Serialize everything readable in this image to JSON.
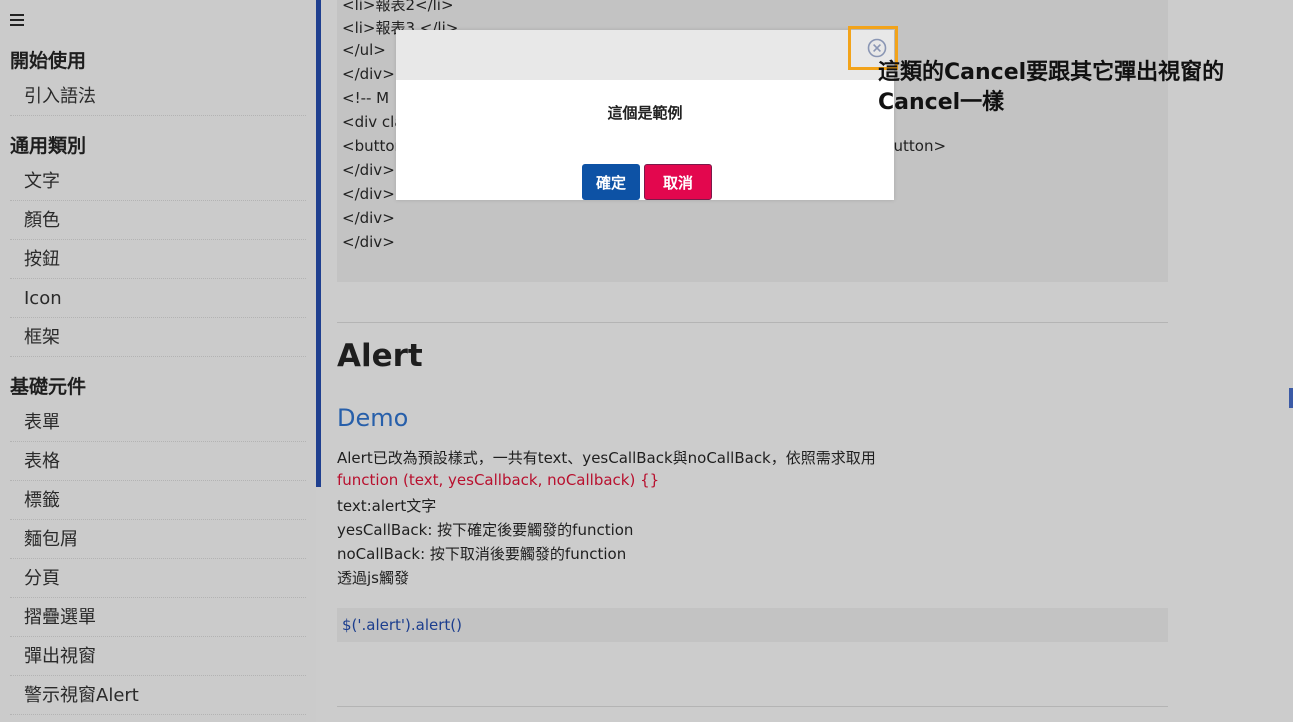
{
  "sidebar": {
    "sections": [
      {
        "title": "開始使用",
        "items": [
          "引入語法"
        ]
      },
      {
        "title": "通用類別",
        "items": [
          "文字",
          "顏色",
          "按鈕",
          "Icon",
          "框架"
        ]
      },
      {
        "title": "基礎元件",
        "items": [
          "表單",
          "表格",
          "標籤",
          "麵包屑",
          "分頁",
          "摺疊選單",
          "彈出視窗",
          "警示視窗Alert"
        ]
      }
    ]
  },
  "code": {
    "lines": [
      "<li>報表2</li>",
      "<li>報表3 </li>",
      "</ul>",
      "</div>",
      "<!-- M",
      "<div cla",
      "<buttor",
      "</div>",
      "</div>",
      "</div>",
      "</div>"
    ],
    "overflow": "button>"
  },
  "alert_section": {
    "title": "Alert",
    "demo_title": "Demo",
    "description": [
      {
        "text": "Alert已改為預設樣式，一共有text、yesCallBack與noCallBack，依照需求取用",
        "color": "#1f1f1f"
      },
      {
        "text": "function (text, yesCallback, noCallback) {}",
        "color": "#b8102e"
      },
      {
        "text": "text:alert文字",
        "color": "#1f1f1f"
      },
      {
        "text": "yesCallBack: 按下確定後要觸發的function",
        "color": "#1f1f1f"
      },
      {
        "text": "noCallBack: 按下取消後要觸發的function",
        "color": "#1f1f1f"
      },
      {
        "text": "透過js觸發",
        "color": "#1f1f1f"
      }
    ],
    "snippet": "$('.alert').alert()"
  },
  "modal": {
    "message": "這個是範例",
    "ok_label": "確定",
    "cancel_label": "取消"
  },
  "annotation": {
    "text": "這類的Cancel要跟其它彈出視窗的Cancel一樣"
  },
  "colors": {
    "accent": "#1f3f8f",
    "ok_button": "#0d52a5",
    "cancel_button": "#e3074e",
    "highlight": "#f2a31a",
    "link": "#275faa"
  }
}
